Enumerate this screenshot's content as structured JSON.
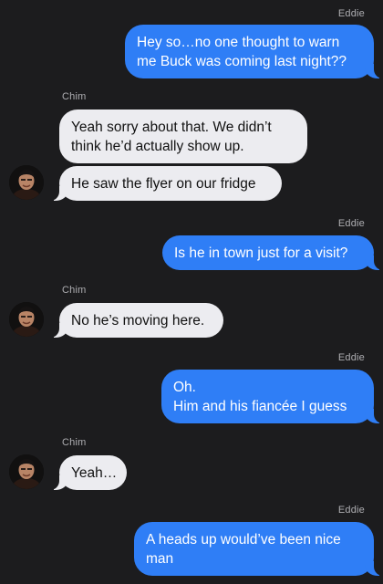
{
  "conversation": {
    "messages": [
      {
        "sender": "Eddie",
        "direction": "outgoing",
        "text": "Hey so…no one thought to warn me Buck was coming last night??"
      },
      {
        "sender": "Chim",
        "direction": "incoming",
        "text": "Yeah sorry about that. We didn’t think he’d actually show up."
      },
      {
        "sender": "Chim",
        "direction": "incoming",
        "text": "He saw the flyer on our fridge"
      },
      {
        "sender": "Eddie",
        "direction": "outgoing",
        "text": "Is he in town just for a visit?"
      },
      {
        "sender": "Chim",
        "direction": "incoming",
        "text": "No he’s moving here."
      },
      {
        "sender": "Eddie",
        "direction": "outgoing",
        "text": "Oh.\nHim and his fiancée I guess"
      },
      {
        "sender": "Chim",
        "direction": "incoming",
        "text": "Yeah…"
      },
      {
        "sender": "Eddie",
        "direction": "outgoing",
        "text": "A heads up would’ve been nice man"
      }
    ]
  },
  "colors": {
    "background": "#1c1c1e",
    "outgoing_bubble": "#2f7ef6",
    "incoming_bubble": "#ececf0",
    "sender_label": "#aeaeb2"
  },
  "icons": {
    "avatar": "contact-photo-chim"
  }
}
